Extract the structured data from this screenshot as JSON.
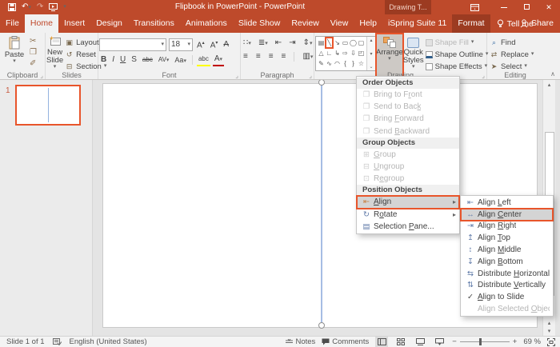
{
  "glyphs": {
    "dropdown": "▾",
    "submenu_arrow": "▸",
    "up_arrow": "▴",
    "down_arrow": "▾",
    "more": "⌄",
    "collapse": "∧",
    "launcher": "⌟",
    "close": "✕",
    "undo": "↶",
    "redo": "↷",
    "cut": "✂",
    "copy": "❐",
    "painter": "✐",
    "layout_icon": "▣",
    "reset_icon": "↺",
    "section_icon": "⊟",
    "minus": "−",
    "plus": "+",
    "check": "✓",
    "columns": "▥",
    "spacing": "⇕",
    "dec_indent": "⇤",
    "inc_indent": "⇥",
    "bullets": "∷",
    "numbering": "≣",
    "align_text": "≡",
    "find_icon": "⌕",
    "replace_icon": "⇄",
    "select_icon": "➤"
  },
  "titlebar": {
    "title": "Flipbook in PowerPoint - PowerPoint",
    "contextual_group": "Drawing T..."
  },
  "tabs": {
    "list": [
      "File",
      "Home",
      "Insert",
      "Design",
      "Transitions",
      "Animations",
      "Slide Show",
      "Review",
      "View",
      "Help",
      "iSpring Suite 11",
      "Format"
    ],
    "tellme": "Tell me",
    "share": "Share"
  },
  "ribbon": {
    "clipboard": {
      "group": "Clipboard",
      "paste": "Paste"
    },
    "slides": {
      "group": "Slides",
      "new_slide": "New Slide",
      "layout": "Layout",
      "reset": "Reset",
      "section": "Section"
    },
    "font": {
      "group": "Font",
      "size": "18",
      "bold": "B",
      "italic": "I",
      "underline": "U",
      "shadow": "S",
      "strike": "abc",
      "spacing": "AV",
      "case": "Aa",
      "color": "A",
      "grow": "A",
      "shrink": "A",
      "clear": "A"
    },
    "paragraph": {
      "group": "Paragraph"
    },
    "drawing": {
      "group": "Drawing",
      "arrange": "Arrange",
      "quick_styles": "Quick Styles",
      "shape_fill": "Shape Fill",
      "shape_outline": "Shape Outline",
      "shape_effects": "Shape Effects"
    },
    "editing": {
      "group": "Editing",
      "find": "Find",
      "replace": "Replace",
      "select": "Select"
    },
    "gallery": {
      "row1": [
        "▤",
        "╲",
        "↘",
        "▭",
        "◯",
        "▢"
      ],
      "row2": [
        "△",
        "∟",
        "↳",
        "⇨",
        "⇩",
        "◰"
      ],
      "row3": [
        "✎",
        "∿",
        "◠",
        "{",
        "}",
        "☆"
      ]
    }
  },
  "arrange_menu": {
    "rows": [
      {
        "type": "header",
        "label": "Order Objects"
      },
      {
        "type": "item",
        "icon": "❐",
        "label": "Bring to F~r~ont",
        "disabled": true
      },
      {
        "type": "item",
        "icon": "❐",
        "label": "Send to Bac~k~",
        "disabled": true
      },
      {
        "type": "item",
        "icon": "❐",
        "label": "Bring ~F~orward",
        "disabled": true
      },
      {
        "type": "item",
        "icon": "❐",
        "label": "Send ~B~ackward",
        "disabled": true
      },
      {
        "type": "header",
        "label": "Group Objects"
      },
      {
        "type": "item",
        "icon": "⊞",
        "label": "~G~roup",
        "disabled": true
      },
      {
        "type": "item",
        "icon": "⊟",
        "label": "~U~ngroup",
        "disabled": true
      },
      {
        "type": "item",
        "icon": "⊡",
        "label": "R~e~group",
        "disabled": true
      },
      {
        "type": "header",
        "label": "Position Objects"
      },
      {
        "type": "item",
        "icon": "⇤",
        "label": "~A~lign",
        "submenu": true,
        "highlighted": true
      },
      {
        "type": "item",
        "icon": "↻",
        "label": "R~o~tate",
        "submenu": true
      },
      {
        "type": "item",
        "icon": "▤",
        "label": "Selection ~P~ane..."
      }
    ]
  },
  "align_submenu": {
    "items": [
      {
        "icon": "⇤",
        "label": "Align ~L~eft"
      },
      {
        "icon": "↔",
        "label": "Align ~C~enter",
        "highlighted": true
      },
      {
        "icon": "⇥",
        "label": "Align ~R~ight"
      },
      {
        "icon": "↥",
        "label": "Align ~T~op"
      },
      {
        "icon": "↕",
        "label": "Align ~M~iddle"
      },
      {
        "icon": "↧",
        "label": "Align ~B~ottom"
      },
      {
        "icon": "⇆",
        "label": "Distribute ~H~orizontally"
      },
      {
        "icon": "⇅",
        "label": "Distribute ~V~ertically"
      },
      {
        "icon": "✓",
        "label": "~A~lign to Slide",
        "checked": true
      },
      {
        "icon": "",
        "label": "Align Selected ~O~bjects",
        "disabled": true
      }
    ]
  },
  "slides_panel": {
    "slide_number": "1"
  },
  "statusbar": {
    "slide_counter": "Slide 1 of 1",
    "language": "English (United States)",
    "notes": "Notes",
    "comments": "Comments",
    "zoom_percent": "69 %"
  },
  "colors": {
    "accent": "#E8552B",
    "titlebar": "#BE4A2B",
    "contextual": "#9C3B21",
    "selection_blue": "#94B3DF"
  }
}
